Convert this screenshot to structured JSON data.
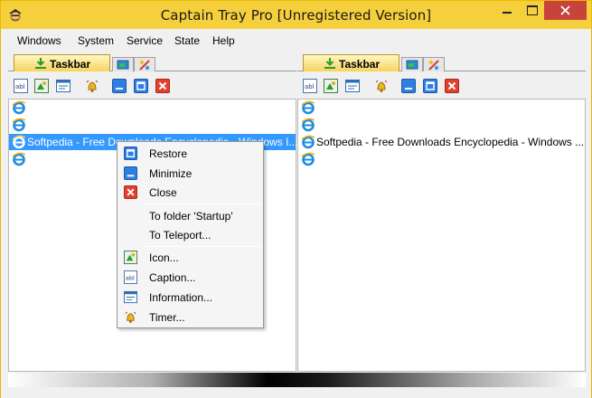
{
  "window": {
    "title": "Captain Tray Pro  [Unregistered Version]"
  },
  "menu": [
    "Windows",
    "System",
    "Service",
    "State",
    "Help"
  ],
  "left_pane": {
    "tab_label": "Taskbar",
    "rows": [
      {
        "text": "",
        "selected": false
      },
      {
        "text": "",
        "selected": false
      },
      {
        "text": "Softpedia - Free Downloads Encyclopedia - Windows I...",
        "selected": true
      },
      {
        "text": "",
        "selected": false
      }
    ]
  },
  "right_pane": {
    "tab_label": "Taskbar",
    "rows": [
      {
        "text": "",
        "selected": false
      },
      {
        "text": "",
        "selected": false
      },
      {
        "text": "Softpedia - Free Downloads Encyclopedia - Windows ...",
        "selected": false
      },
      {
        "text": "",
        "selected": false
      }
    ]
  },
  "toolbar_icons": [
    "caption-icon",
    "window-icon-icon",
    "information-icon",
    "timer-icon",
    "minimize-icon",
    "restore-icon",
    "close-icon"
  ],
  "context_menu": {
    "items": [
      {
        "label": "Restore",
        "icon": "restore-icon"
      },
      {
        "label": "Minimize",
        "icon": "minimize-icon"
      },
      {
        "label": "Close",
        "icon": "close-icon"
      },
      {
        "label": "To folder 'Startup'",
        "icon": ""
      },
      {
        "label": "To Teleport...",
        "icon": ""
      },
      {
        "label": "Icon...",
        "icon": "window-icon-icon"
      },
      {
        "label": "Caption...",
        "icon": "caption-icon"
      },
      {
        "label": "Information...",
        "icon": "information-icon"
      },
      {
        "label": "Timer...",
        "icon": "timer-icon"
      }
    ]
  },
  "colors": {
    "title_bar": "#f6cf3c",
    "selection": "#3399ff",
    "close_button": "#c7433b"
  }
}
